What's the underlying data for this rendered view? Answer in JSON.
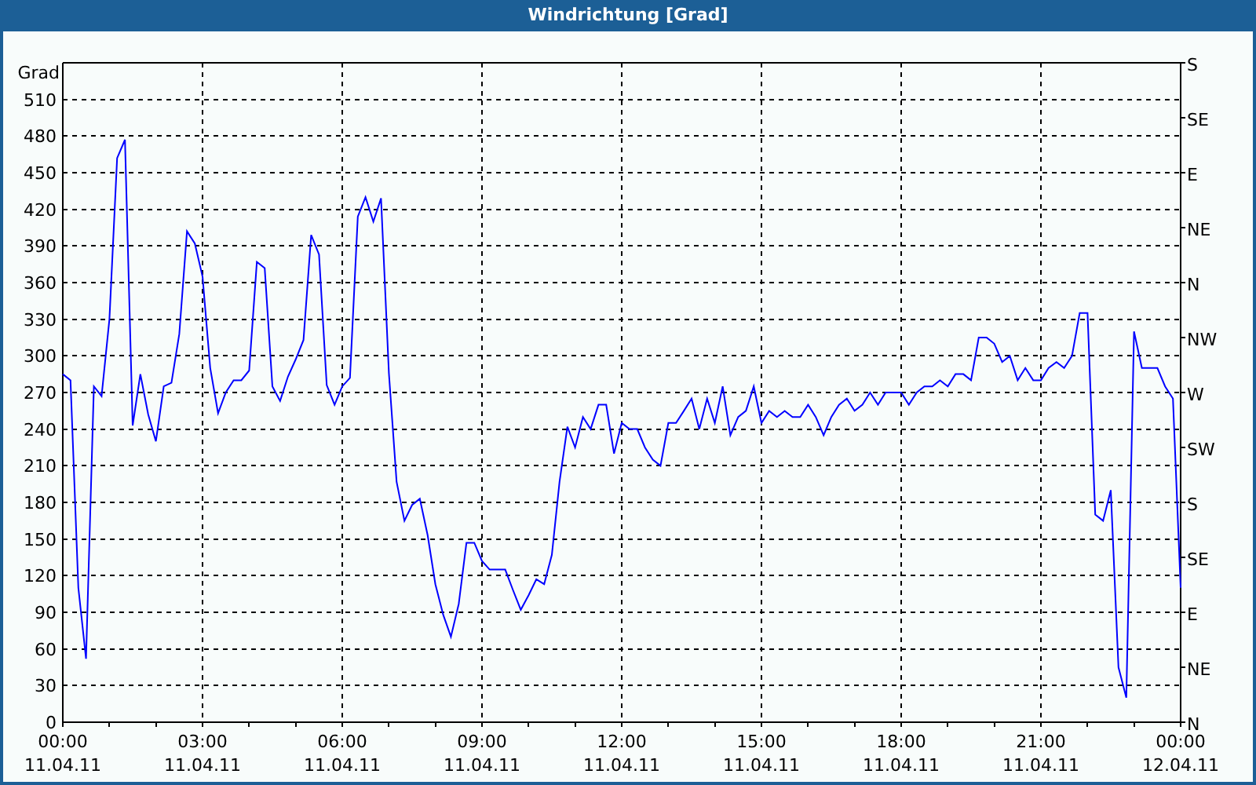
{
  "window": {
    "title": "Windrichtung [Grad]"
  },
  "chart": {
    "chart_data": {
      "type": "line",
      "grid": true,
      "ylabel": "Grad",
      "ylim": [
        0,
        540
      ],
      "yticks": [
        0,
        30,
        60,
        90,
        120,
        150,
        180,
        210,
        240,
        270,
        300,
        330,
        360,
        390,
        420,
        450,
        480,
        510
      ],
      "categories": [
        "00:00\n11.04.11",
        null,
        null,
        null,
        null,
        null,
        null,
        null,
        null,
        null,
        null,
        null,
        null,
        null,
        null,
        null,
        null,
        null,
        "03:00\n11.04.11",
        null,
        null,
        null,
        null,
        null,
        null,
        null,
        null,
        null,
        null,
        null,
        null,
        null,
        null,
        null,
        null,
        null,
        "06:00\n11.04.11",
        null,
        null,
        null,
        null,
        null,
        null,
        null,
        null,
        null,
        null,
        null,
        null,
        null,
        null,
        null,
        null,
        null,
        "09:00\n11.04.11",
        null,
        null,
        null,
        null,
        null,
        null,
        null,
        null,
        null,
        null,
        null,
        null,
        null,
        null,
        null,
        null,
        null,
        "12:00\n11.04.11",
        null,
        null,
        null,
        null,
        null,
        null,
        null,
        null,
        null,
        null,
        null,
        null,
        null,
        null,
        null,
        null,
        null,
        "15:00\n11.04.11",
        null,
        null,
        null,
        null,
        null,
        null,
        null,
        null,
        null,
        null,
        null,
        null,
        null,
        null,
        null,
        null,
        null,
        "18:00\n11.04.11",
        null,
        null,
        null,
        null,
        null,
        null,
        null,
        null,
        null,
        null,
        null,
        null,
        null,
        null,
        null,
        null,
        null,
        "21:00\n11.04.11",
        null,
        null,
        null,
        null,
        null,
        null,
        null,
        null,
        null,
        null,
        null,
        null,
        null,
        null,
        null,
        null,
        null,
        "00:00\n12.04.11"
      ],
      "series": [
        {
          "color": "#0000ff",
          "values": [
            285,
            280,
            110,
            52,
            275,
            267,
            330,
            462,
            477,
            243,
            285,
            252,
            230,
            275,
            278,
            318,
            402,
            392,
            365,
            290,
            253,
            270,
            280,
            280,
            288,
            377,
            372,
            275,
            263,
            283,
            297,
            313,
            399,
            383,
            276,
            260,
            275,
            282,
            414,
            430,
            410,
            429,
            286,
            197,
            165,
            178,
            183,
            153,
            113,
            88,
            70,
            97,
            147,
            147,
            132,
            125,
            125,
            125,
            108,
            92,
            104,
            117,
            113,
            137,
            197,
            242,
            225,
            250,
            240,
            260,
            260,
            220,
            245,
            240,
            240,
            225,
            215,
            210,
            245,
            245,
            255,
            265,
            240,
            265,
            245,
            275,
            235,
            250,
            255,
            275,
            245,
            255,
            250,
            255,
            250,
            250,
            260,
            250,
            235,
            250,
            260,
            265,
            255,
            260,
            270,
            260,
            270,
            270,
            270,
            260,
            270,
            275,
            275,
            280,
            275,
            285,
            285,
            280,
            315,
            315,
            310,
            295,
            300,
            280,
            290,
            280,
            280,
            290,
            295,
            290,
            300,
            335,
            335,
            170,
            165,
            190,
            45,
            20,
            320,
            290,
            290,
            290,
            275,
            265,
            110
          ]
        }
      ]
    },
    "right_axis": {
      "labels": [
        "S",
        "SE",
        "E",
        "NE",
        "N",
        "NW",
        "W",
        "SW",
        "S",
        "SE",
        "E",
        "NE",
        "N"
      ]
    }
  }
}
